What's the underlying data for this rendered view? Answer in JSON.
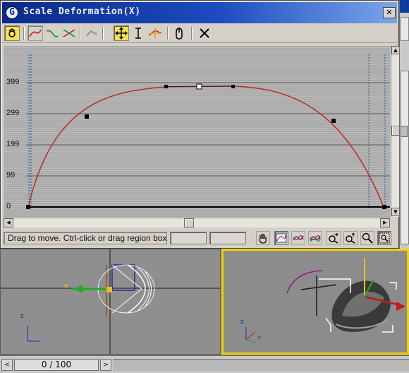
{
  "dialog": {
    "title": "Scale Deformation(X)",
    "close_label": "✕"
  },
  "toolbar": {
    "buttons": [
      {
        "name": "make-symmetrical-icon",
        "active": true
      },
      {
        "name": "display-x-axis-icon",
        "pressed": true
      },
      {
        "name": "display-y-axis-icon"
      },
      {
        "name": "display-xy-axes-icon"
      },
      {
        "name": "swap-deform-curves-icon"
      },
      {
        "name": "move-control-point-icon",
        "active": true
      },
      {
        "name": "scale-control-point-icon"
      },
      {
        "name": "insert-corner-point-icon"
      },
      {
        "name": "delete-control-point-icon"
      },
      {
        "name": "reset-curve-icon"
      }
    ]
  },
  "graph": {
    "y_ticks": [
      "399",
      "299",
      "199",
      "99",
      "0"
    ],
    "curve_color": "#c0282a"
  },
  "status": {
    "message": "Drag to move. Ctrl-click or drag region box to add",
    "field1": "",
    "field2": ""
  },
  "status_buttons": [
    "pan-hand-icon",
    "zoom-extents-icon",
    "zoom-horizontal-extents-icon",
    "zoom-vertical-extents-icon",
    "zoom-horizontal-icon",
    "zoom-vertical-icon",
    "zoom-icon",
    "zoom-region-icon"
  ],
  "timeline": {
    "frame_label": "0 / 100",
    "prev_label": "<",
    "next_label": ">"
  },
  "viewports": {
    "left_axis_x": "x",
    "left_axis_z": "z",
    "right_axis_z": "z",
    "right_axis_x": "x"
  },
  "colors": {
    "title_bar": "#0a2a8a",
    "active_button": "#f4e04a",
    "viewport_highlight": "#f0d000",
    "graph_bg": "#a8a8a8"
  }
}
